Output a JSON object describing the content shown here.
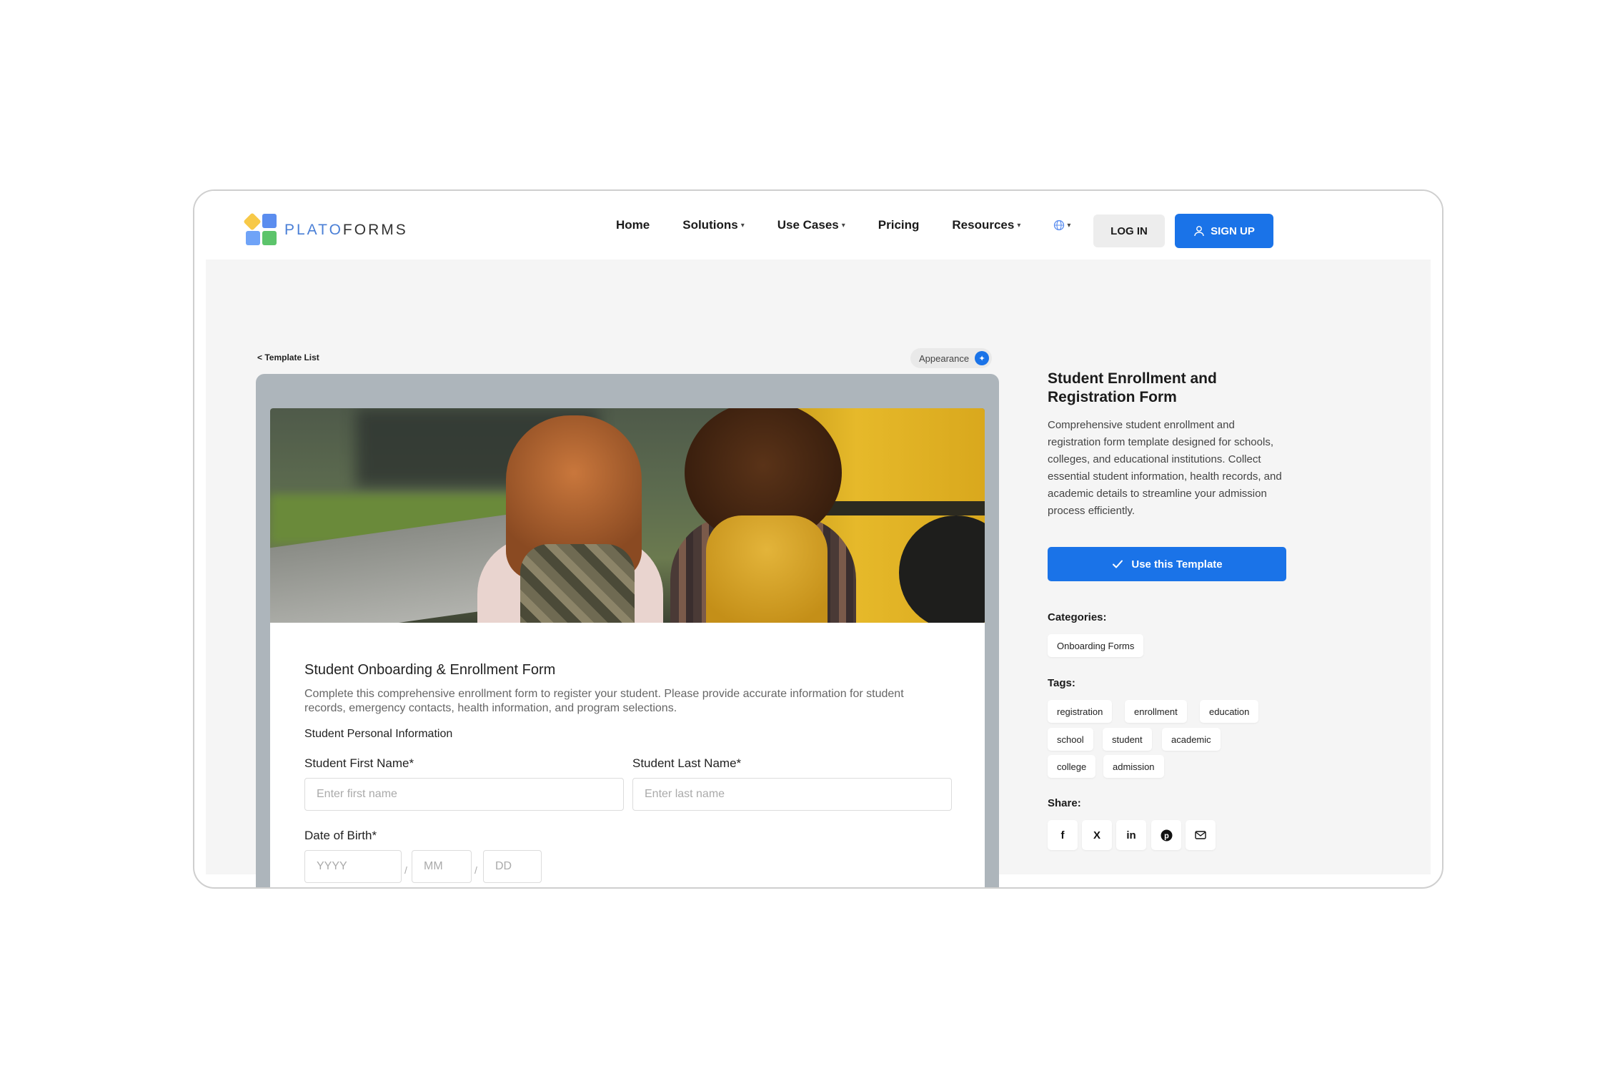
{
  "brand": {
    "name_part1": "PLATO",
    "name_part2": "FORMS"
  },
  "nav": {
    "items": [
      {
        "label": "Home",
        "dropdown": false
      },
      {
        "label": "Solutions",
        "dropdown": true
      },
      {
        "label": "Use Cases",
        "dropdown": true
      },
      {
        "label": "Pricing",
        "dropdown": false
      },
      {
        "label": "Resources",
        "dropdown": true
      }
    ],
    "login_label": "LOG IN",
    "signup_label": "SIGN UP"
  },
  "back_link": "< Template List",
  "appearance_label": "Appearance",
  "form": {
    "title": "Student Onboarding & Enrollment Form",
    "description": "Complete this comprehensive enrollment form to register your student. Please provide accurate information for student records, emergency contacts, health information, and program selections.",
    "section": "Student Personal Information",
    "first_name_label": "Student First Name*",
    "first_name_placeholder": "Enter first name",
    "last_name_label": "Student Last Name*",
    "last_name_placeholder": "Enter last name",
    "dob_label": "Date of Birth*",
    "dob_year": "YYYY",
    "dob_month": "MM",
    "dob_day": "DD",
    "dob_sep": "/"
  },
  "template": {
    "title": "Student Enrollment and Registration Form",
    "description": "Comprehensive student enrollment and registration form template designed for schools, colleges, and educational institutions. Collect essential student information, health records, and academic details to streamline your admission process efficiently.",
    "use_label": "Use this Template",
    "categories_label": "Categories:",
    "categories": [
      "Onboarding Forms"
    ],
    "tags_label": "Tags:",
    "tags": [
      "registration",
      "enrollment",
      "education",
      "school",
      "student",
      "academic",
      "college",
      "admission"
    ],
    "share_label": "Share:",
    "share": [
      "f",
      "X",
      "in",
      "P",
      "mail"
    ]
  },
  "colors": {
    "accent": "#1a73e8",
    "preview_bg": "#adb5bb",
    "page_bg": "#f5f5f5"
  }
}
